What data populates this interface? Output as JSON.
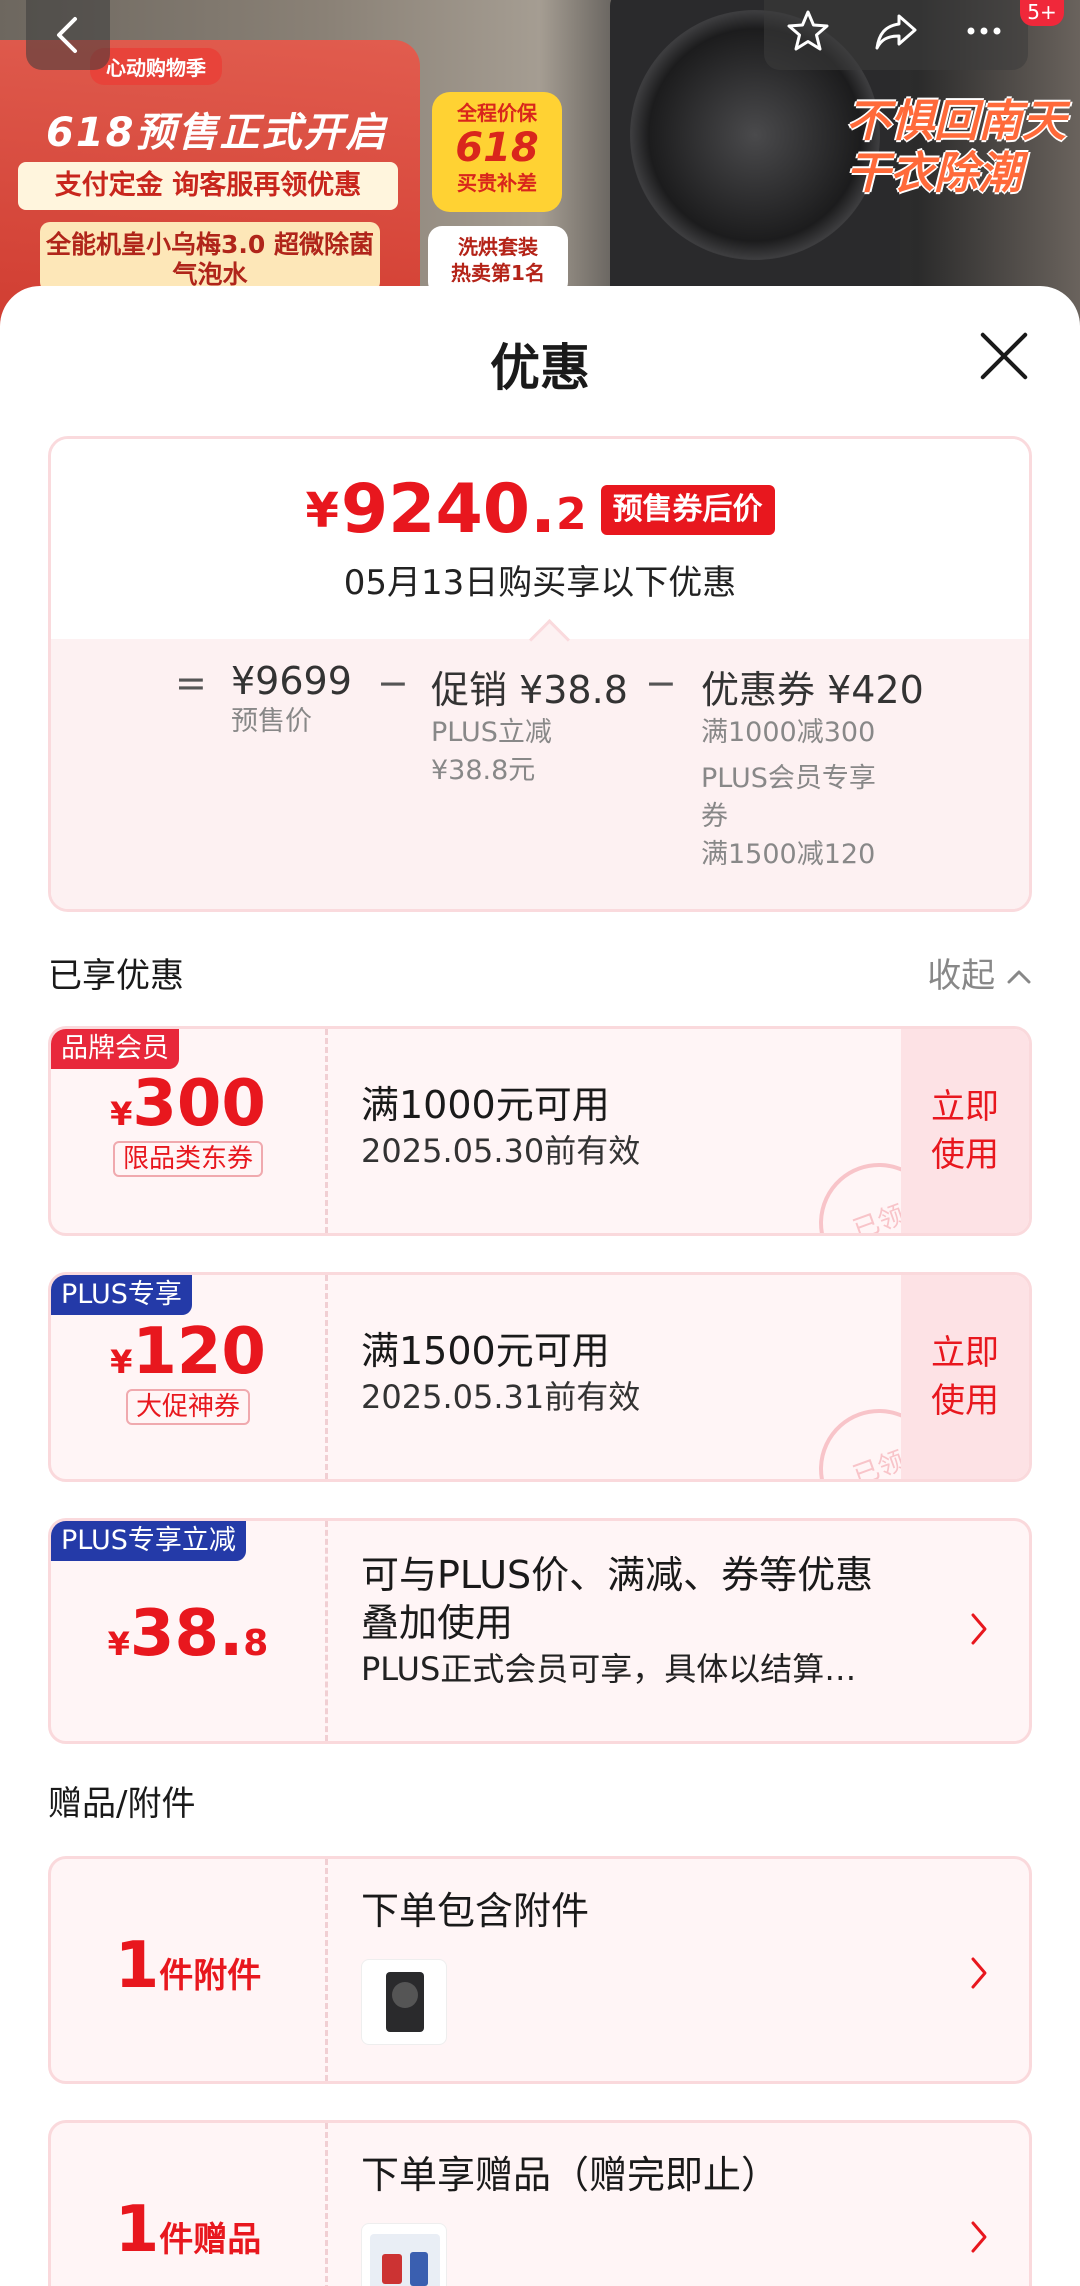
{
  "banner": {
    "promo_tag": "心动购物季",
    "promo_title": "618预售正式开启",
    "promo_sub": "支付定金 询客服再领优惠",
    "promo_box": "全能机皇小乌梅3.0 超微除菌气泡水",
    "badge_line1": "全程价保",
    "badge_line2": "618",
    "badge_line3": "买贵补差",
    "top_line1": "洗烘套装",
    "top_line2": "热卖第1名",
    "slogan_line1": "不惧回南天",
    "slogan_line2": "干衣除潮",
    "notification_count": "5+"
  },
  "sheet": {
    "title": "优惠"
  },
  "price_card": {
    "yen": "¥",
    "price_main": "9240.",
    "price_dec": "2",
    "price_tag": "预售券后价",
    "date_text": "05月13日购买享以下优惠",
    "eq": "=",
    "minus1": "−",
    "minus2": "−",
    "col1_value": "¥9699",
    "col1_sub": "预售价",
    "col2_value": "促销 ¥38.8",
    "col2_sub1": "PLUS立减",
    "col2_sub2": "¥38.8元",
    "col3_value": "优惠券 ¥420",
    "col3_sub1": "满1000减300",
    "col3_sub2": "PLUS会员专享",
    "col3_sub3": "券",
    "col3_sub4": "满1500减120"
  },
  "enjoyed": {
    "title": "已享优惠",
    "collapse_label": "收起"
  },
  "coupons": [
    {
      "corner": "品牌会员",
      "yen": "¥",
      "amount": "300",
      "label": "限品类东券",
      "title": "满1000元可用",
      "sub": "2025.05.30前有效",
      "action_line1": "立即",
      "action_line2": "使用",
      "stamp": "已领"
    },
    {
      "corner": "PLUS专享",
      "yen": "¥",
      "amount": "120",
      "label": "大促神券",
      "title": "满1500元可用",
      "sub": "2025.05.31前有效",
      "action_line1": "立即",
      "action_line2": "使用",
      "stamp": "已领"
    },
    {
      "corner": "PLUS专享立减",
      "yen": "¥",
      "amount": "38.",
      "dec": "8",
      "title_line1": "可与PLUS价、满减、券等优惠",
      "title_line2": "叠加使用",
      "sub": "PLUS正式会员可享，具体以结算…"
    }
  ],
  "gifts_section": {
    "title": "赠品/附件"
  },
  "gifts": [
    {
      "count": "1",
      "unit": "件附件",
      "title": "下单包含附件"
    },
    {
      "count": "1",
      "unit": "件赠品",
      "title": "下单享赠品（赠完即止）"
    }
  ]
}
